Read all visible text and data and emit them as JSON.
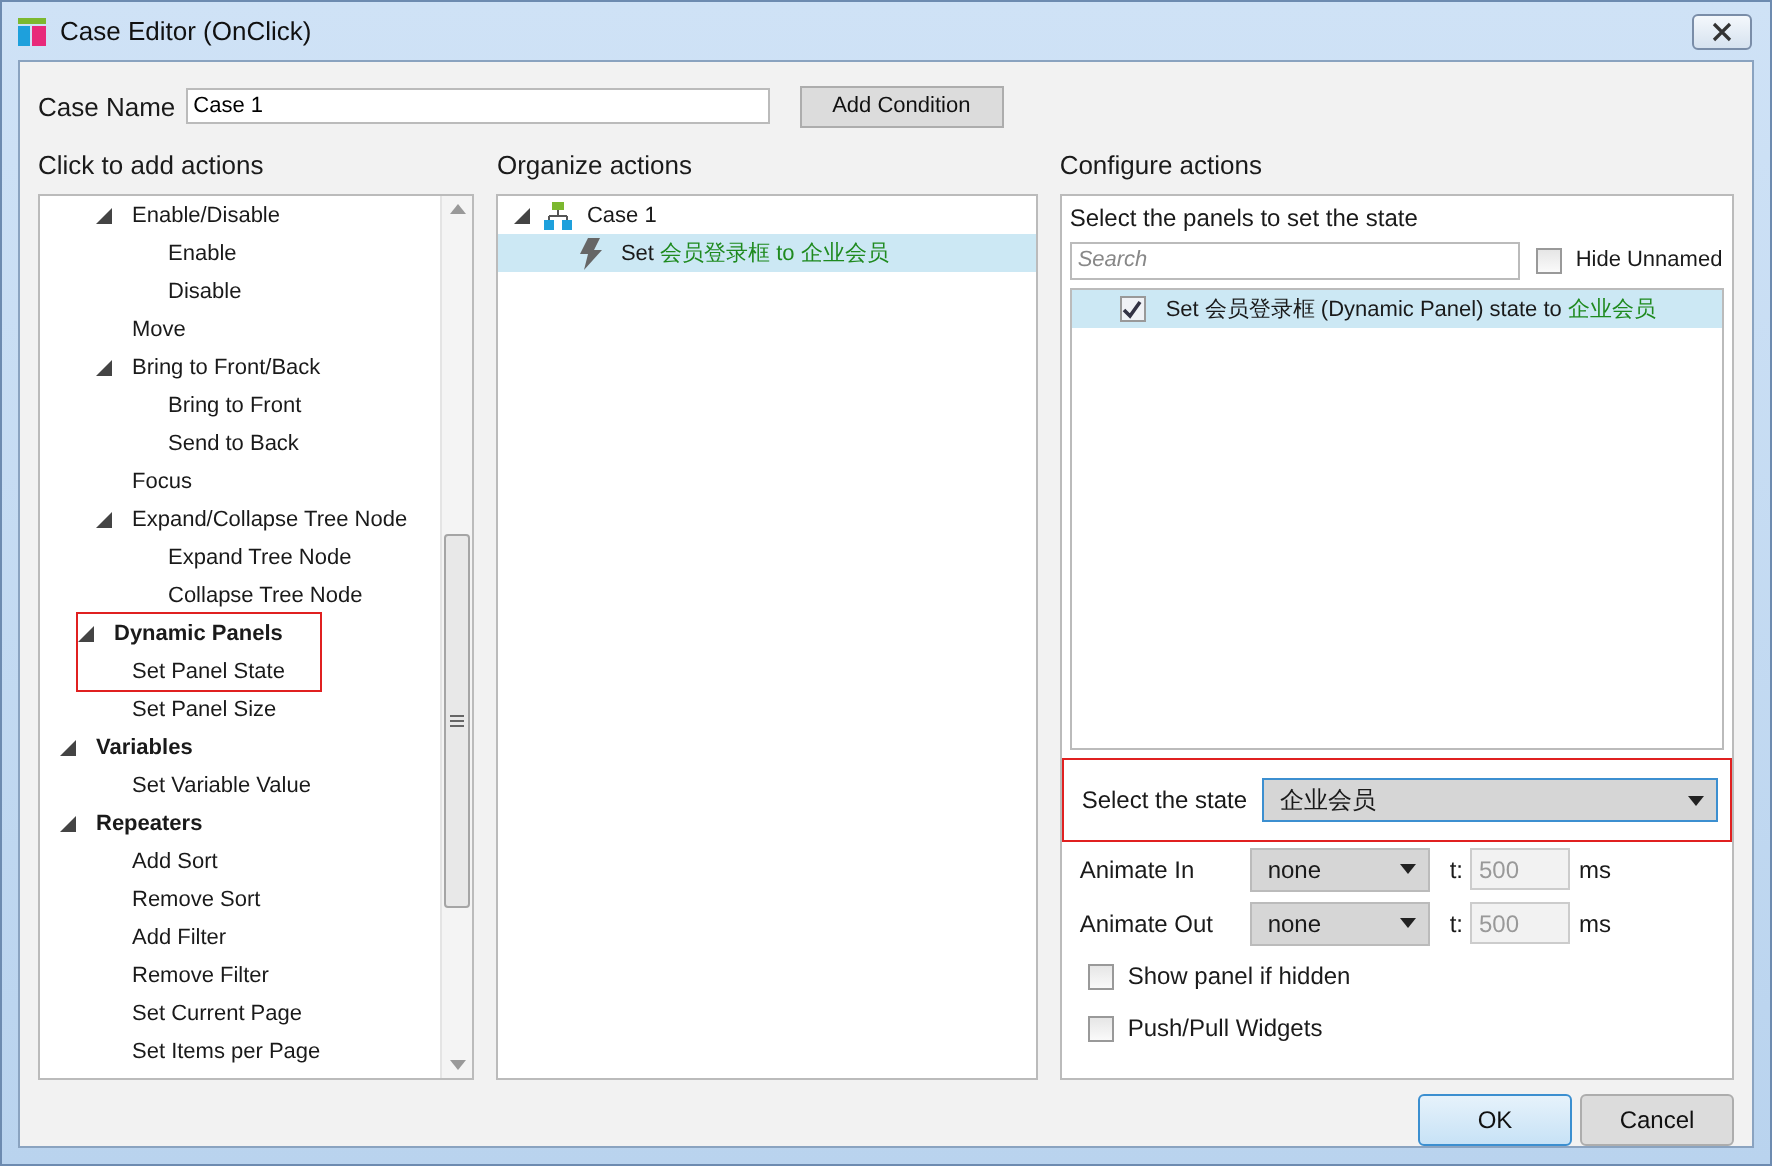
{
  "window": {
    "title": "Case Editor (OnClick)"
  },
  "case_name": {
    "label": "Case Name",
    "value": "Case 1"
  },
  "add_condition_button": "Add Condition",
  "add_actions": {
    "heading": "Click to add actions",
    "items": [
      {
        "label": "Enable/Disable",
        "kind": "action",
        "expanded": true,
        "children": [
          {
            "label": "Enable"
          },
          {
            "label": "Disable"
          }
        ]
      },
      {
        "label": "Move",
        "kind": "action"
      },
      {
        "label": "Bring to Front/Back",
        "kind": "action",
        "expanded": true,
        "children": [
          {
            "label": "Bring to Front"
          },
          {
            "label": "Send to Back"
          }
        ]
      },
      {
        "label": "Focus",
        "kind": "action"
      },
      {
        "label": "Expand/Collapse Tree Node",
        "kind": "action",
        "expanded": true,
        "children": [
          {
            "label": "Expand Tree Node"
          },
          {
            "label": "Collapse Tree Node"
          }
        ]
      },
      {
        "label": "Dynamic Panels",
        "kind": "category",
        "expanded": true,
        "marked": true,
        "children": [
          {
            "label": "Set Panel State",
            "marked": true
          },
          {
            "label": "Set Panel Size"
          }
        ]
      },
      {
        "label": "Variables",
        "kind": "category",
        "expanded": true,
        "children": [
          {
            "label": "Set Variable Value"
          }
        ]
      },
      {
        "label": "Repeaters",
        "kind": "category",
        "expanded": true,
        "children": [
          {
            "label": "Add Sort"
          },
          {
            "label": "Remove Sort"
          },
          {
            "label": "Add Filter"
          },
          {
            "label": "Remove Filter"
          },
          {
            "label": "Set Current Page"
          },
          {
            "label": "Set Items per Page"
          }
        ]
      }
    ]
  },
  "organize_actions": {
    "heading": "Organize actions",
    "cases": [
      {
        "label": "Case 1",
        "expanded": true,
        "actions": [
          {
            "selected": true,
            "parts": [
              {
                "text": "Set ",
                "kind": "plain"
              },
              {
                "text": "会员登录框",
                "kind": "value"
              },
              {
                "text": " to ",
                "kind": "value"
              },
              {
                "text": "企业会员",
                "kind": "value"
              }
            ]
          }
        ]
      }
    ]
  },
  "configure_actions": {
    "heading": "Configure actions",
    "panels_caption": "Select the panels to set the state",
    "search": {
      "placeholder": "Search"
    },
    "hide_unnamed": {
      "label": "Hide Unnamed",
      "checked": false
    },
    "panels": [
      {
        "checked": true,
        "selected": true,
        "parts": [
          {
            "text": "Set 会员登录框 (Dynamic Panel) state to ",
            "kind": "plain"
          },
          {
            "text": "企业会员",
            "kind": "value"
          }
        ]
      }
    ],
    "state_select": {
      "label": "Select the state",
      "value": "企业会员",
      "annotated": true
    },
    "animations": [
      {
        "label": "Animate In",
        "effect": "none",
        "time_label": "t:",
        "time": "500",
        "unit": "ms"
      },
      {
        "label": "Animate Out",
        "effect": "none",
        "time_label": "t:",
        "time": "500",
        "unit": "ms"
      }
    ],
    "options": [
      {
        "label": "Show panel if hidden",
        "checked": false
      },
      {
        "label": "Push/Pull Widgets",
        "checked": false
      }
    ]
  },
  "buttons": [
    {
      "label": "OK",
      "primary": true
    },
    {
      "label": "Cancel",
      "primary": false
    }
  ]
}
